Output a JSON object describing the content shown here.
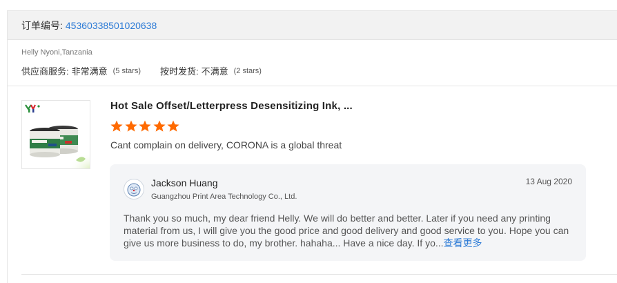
{
  "order": {
    "label": "订单编号:",
    "number": "45360338501020638"
  },
  "buyer": {
    "name": "Helly Nyoni,Tanzania",
    "ratings": [
      {
        "label": "供应商服务:",
        "value": "非常满意",
        "stars": "(5 stars)"
      },
      {
        "label": "按时发货:",
        "value": "不满意",
        "stars": "(2 stars)"
      }
    ]
  },
  "product": {
    "title": "Hot Sale Offset/Letterpress Desensitizing Ink, ...",
    "rating": 5,
    "star_color": "#ff6a00",
    "image_icon": "ink-cans-product-image"
  },
  "review": {
    "text": "Cant complain on delivery, CORONA is a global threat"
  },
  "reply": {
    "seller_name": "Jackson Huang",
    "company": "Guangzhou Print Area Technology Co., Ltd.",
    "date": "13 Aug 2020",
    "text": "Thank you so much, my dear friend Helly. We will do better and better. Later if you need any printing material from us, I will give you the good price and good delivery and good service to you. Hope you can give us more business to do, my brother. hahaha... Have a nice day. If yo...",
    "see_more": "查看更多",
    "avatar_icon": "seller-avatar-icon"
  },
  "colors": {
    "link": "#2d7bd6",
    "header_bg": "#f2f2f2",
    "reply_bg": "#f4f5f7"
  }
}
